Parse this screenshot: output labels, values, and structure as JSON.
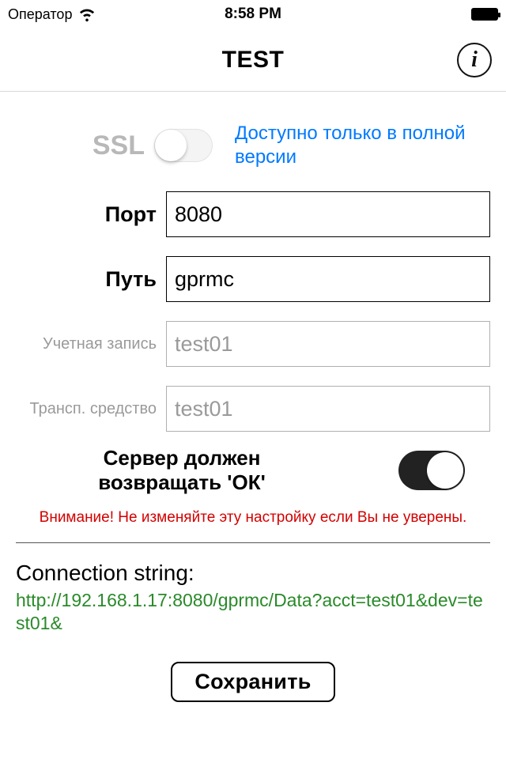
{
  "status_bar": {
    "carrier": "Оператор",
    "time": "8:58 PM"
  },
  "nav": {
    "title": "TEST"
  },
  "ssl": {
    "label": "SSL",
    "on": false,
    "note": "Доступно только в полной версии"
  },
  "form": {
    "port": {
      "label": "Порт",
      "value": "8080"
    },
    "path": {
      "label": "Путь",
      "value": "gprmc"
    },
    "account": {
      "label": "Учетная запись",
      "value": "test01"
    },
    "vehicle": {
      "label": "Трансп. средство",
      "value": "test01"
    }
  },
  "ok_return": {
    "text": "Сервер должен возвращать 'ОК'",
    "on": true
  },
  "warning": "Внимание! Не изменяйте эту настройку если Вы не уверены.",
  "connection": {
    "label": "Connection string:",
    "value": "http://192.168.1.17:8080/gprmc/Data?acct=test01&dev=test01&"
  },
  "save_label": "Сохранить"
}
